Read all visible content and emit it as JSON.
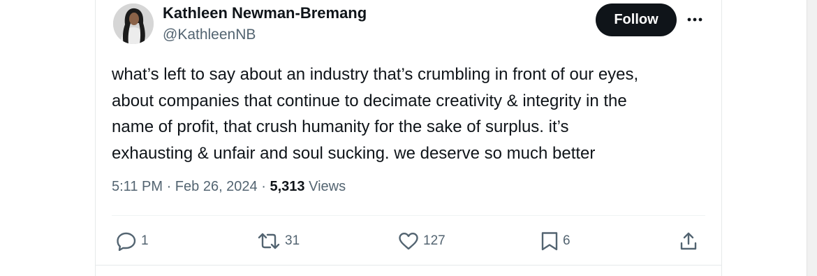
{
  "author": {
    "name": "Kathleen Newman-Bremang",
    "handle": "@KathleenNB"
  },
  "follow_label": "Follow",
  "tweet": {
    "text": "what’s left to say about an industry that’s crumbling in front of our eyes,\nabout companies that continue to decimate creativity & integrity in the\nname of profit, that crush humanity for the sake of surplus. it’s\nexhausting & unfair and soul sucking. we deserve so much better"
  },
  "meta": {
    "time": "5:11 PM",
    "separator": "·",
    "date": "Feb 26, 2024",
    "views_count": "5,313",
    "views_label": "Views"
  },
  "actions": {
    "reply": {
      "icon": "reply-icon",
      "count": "1"
    },
    "retweet": {
      "icon": "retweet-icon",
      "count": "31"
    },
    "like": {
      "icon": "heart-icon",
      "count": "127"
    },
    "bookmark": {
      "icon": "bookmark-icon",
      "count": "6"
    },
    "share": {
      "icon": "share-icon"
    }
  },
  "colors": {
    "text_primary": "#0f1419",
    "text_secondary": "#536471",
    "follow_bg": "#0f1419",
    "follow_text": "#ffffff"
  }
}
